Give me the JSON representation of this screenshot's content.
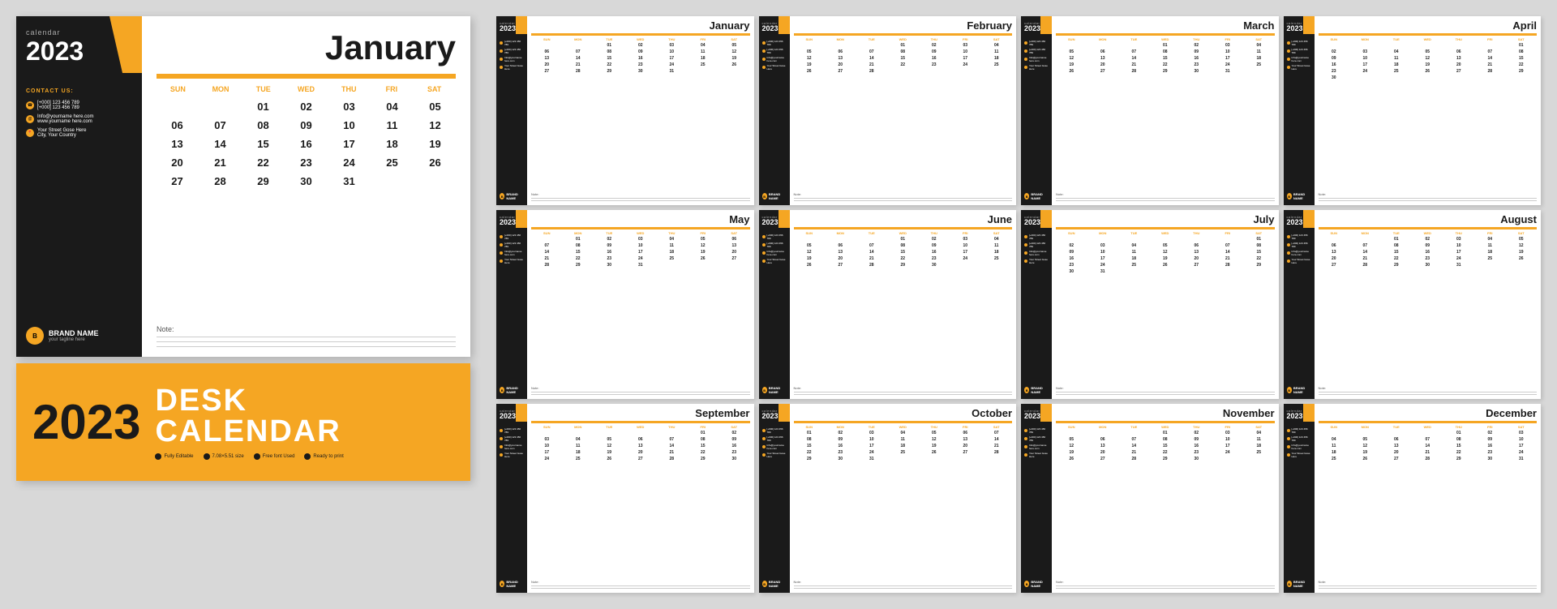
{
  "calendar": {
    "label": "calendar",
    "year": "2023",
    "brand": {
      "name": "BRAND NAME",
      "tagline": "your tagline here",
      "icon": "B"
    },
    "contact": {
      "title": "CONTACT US:",
      "phone": "[+000] 123 456 789",
      "phone2": "[+000] 123 456 789",
      "email": "Info@yourname here.com",
      "website": "www.yourname here.com",
      "address": "Your Street Gose Here",
      "city": "City, Your Country"
    },
    "note_label": "Note:",
    "months": [
      {
        "name": "January",
        "days": [
          "",
          "",
          "01",
          "02",
          "03",
          "04",
          "05",
          "06",
          "07",
          "08",
          "09",
          "10",
          "11",
          "12",
          "13",
          "14",
          "15",
          "16",
          "17",
          "18",
          "19",
          "20",
          "21",
          "22",
          "23",
          "24",
          "25",
          "26",
          "27",
          "28",
          "29",
          "30",
          "31"
        ]
      },
      {
        "name": "February",
        "days": [
          "",
          "",
          "",
          "01",
          "02",
          "03",
          "04",
          "05",
          "06",
          "07",
          "08",
          "09",
          "10",
          "11",
          "12",
          "13",
          "14",
          "15",
          "16",
          "17",
          "18",
          "19",
          "20",
          "21",
          "22",
          "23",
          "24",
          "25",
          "26",
          "27",
          "28"
        ]
      },
      {
        "name": "March",
        "days": [
          "",
          "",
          "",
          "01",
          "02",
          "03",
          "04",
          "05",
          "06",
          "07",
          "08",
          "09",
          "10",
          "11",
          "12",
          "13",
          "14",
          "15",
          "16",
          "17",
          "18",
          "19",
          "20",
          "21",
          "22",
          "23",
          "24",
          "25",
          "26",
          "27",
          "28",
          "29",
          "30",
          "31"
        ]
      },
      {
        "name": "April",
        "days": [
          "",
          "",
          "",
          "",
          "",
          "",
          "01",
          "02",
          "03",
          "04",
          "05",
          "06",
          "07",
          "08",
          "09",
          "10",
          "11",
          "12",
          "13",
          "14",
          "15",
          "16",
          "17",
          "18",
          "19",
          "20",
          "21",
          "22",
          "23",
          "24",
          "25",
          "26",
          "27",
          "28",
          "29",
          "30"
        ]
      },
      {
        "name": "May",
        "days": [
          "",
          "01",
          "02",
          "03",
          "04",
          "05",
          "06",
          "07",
          "08",
          "09",
          "10",
          "11",
          "12",
          "13",
          "14",
          "15",
          "16",
          "17",
          "18",
          "19",
          "20",
          "21",
          "22",
          "23",
          "24",
          "25",
          "26",
          "27",
          "28",
          "29",
          "30",
          "31"
        ]
      },
      {
        "name": "June",
        "days": [
          "",
          "",
          "",
          "01",
          "02",
          "03",
          "04",
          "05",
          "06",
          "07",
          "08",
          "09",
          "10",
          "11",
          "12",
          "13",
          "14",
          "15",
          "16",
          "17",
          "18",
          "19",
          "20",
          "21",
          "22",
          "23",
          "24",
          "25",
          "26",
          "27",
          "28",
          "29",
          "30"
        ]
      },
      {
        "name": "July",
        "days": [
          "",
          "",
          "",
          "",
          "",
          "",
          "01",
          "02",
          "03",
          "04",
          "05",
          "06",
          "07",
          "08",
          "09",
          "10",
          "11",
          "12",
          "13",
          "14",
          "15",
          "16",
          "17",
          "18",
          "19",
          "20",
          "21",
          "22",
          "23",
          "24",
          "25",
          "26",
          "27",
          "28",
          "29",
          "30",
          "31"
        ]
      },
      {
        "name": "August",
        "days": [
          "",
          "",
          "01",
          "02",
          "03",
          "04",
          "05",
          "06",
          "07",
          "08",
          "09",
          "10",
          "11",
          "12",
          "13",
          "14",
          "15",
          "16",
          "17",
          "18",
          "19",
          "20",
          "21",
          "22",
          "23",
          "24",
          "25",
          "26",
          "27",
          "28",
          "29",
          "30",
          "31"
        ]
      },
      {
        "name": "September",
        "days": [
          "",
          "",
          "",
          "",
          "",
          "01",
          "02",
          "03",
          "04",
          "05",
          "06",
          "07",
          "08",
          "09",
          "10",
          "11",
          "12",
          "13",
          "14",
          "15",
          "16",
          "17",
          "18",
          "19",
          "20",
          "21",
          "22",
          "23",
          "24",
          "25",
          "26",
          "27",
          "28",
          "29",
          "30"
        ]
      },
      {
        "name": "October",
        "days": [
          "01",
          "02",
          "03",
          "04",
          "05",
          "06",
          "07",
          "08",
          "09",
          "10",
          "11",
          "12",
          "13",
          "14",
          "15",
          "16",
          "17",
          "18",
          "19",
          "20",
          "21",
          "22",
          "23",
          "24",
          "25",
          "26",
          "27",
          "28",
          "29",
          "30",
          "31"
        ]
      },
      {
        "name": "November",
        "days": [
          "",
          "",
          "",
          "01",
          "02",
          "03",
          "04",
          "05",
          "06",
          "07",
          "08",
          "09",
          "10",
          "11",
          "12",
          "13",
          "14",
          "15",
          "16",
          "17",
          "18",
          "19",
          "20",
          "21",
          "22",
          "23",
          "24",
          "25",
          "26",
          "27",
          "28",
          "29",
          "30"
        ]
      },
      {
        "name": "December",
        "days": [
          "",
          "",
          "",
          "",
          "01",
          "02",
          "03",
          "04",
          "05",
          "06",
          "07",
          "08",
          "09",
          "10",
          "11",
          "12",
          "13",
          "14",
          "15",
          "16",
          "17",
          "18",
          "19",
          "20",
          "21",
          "22",
          "23",
          "24",
          "25",
          "26",
          "27",
          "28",
          "29",
          "30",
          "31"
        ]
      }
    ],
    "day_headers": [
      "SUN",
      "MON",
      "TUE",
      "WED",
      "THU",
      "FRI",
      "SAT"
    ]
  },
  "cover": {
    "year": "2023",
    "title_line1": "DESK",
    "title_line2": "CALENDAR",
    "features": [
      "Fully Editable",
      "7.08×5.51 size",
      "Free font Used",
      "Ready to print"
    ]
  },
  "colors": {
    "yellow": "#f5a623",
    "dark": "#1a1a1a",
    "white": "#ffffff"
  }
}
